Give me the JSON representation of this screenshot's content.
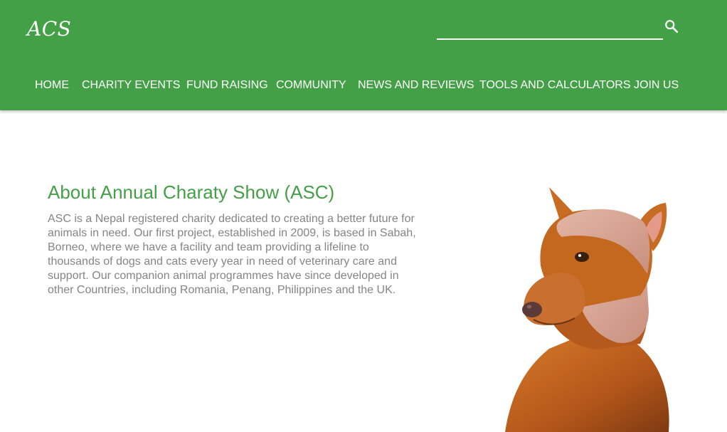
{
  "header": {
    "logo": "ACS",
    "search": {
      "placeholder": "",
      "value": ""
    },
    "nav": [
      "HOME",
      "CHARITY EVENTS",
      "FUND RAISING",
      "COMMUNITY",
      "NEWS AND REVIEWS",
      "TOOLS AND CALCULATORS",
      "JOIN US"
    ]
  },
  "main": {
    "title": "About Annual Charaty Show (ASC)",
    "text": "ASC is a Nepal registered charity dedicated to creating a better future for animals in need. Our first project, established in 2009, is based in Sabah, Borneo, where we have a facility and team providing a lifeline to thousands of dogs and cats every year in need of veterinary care and support. Our companion animal programmes have since developed in other Countries, including Romania, Penang, Philippines and the UK."
  },
  "colors": {
    "brand_green": "#43a047",
    "body_text": "#858585"
  },
  "icons": {
    "search": "search-icon"
  }
}
